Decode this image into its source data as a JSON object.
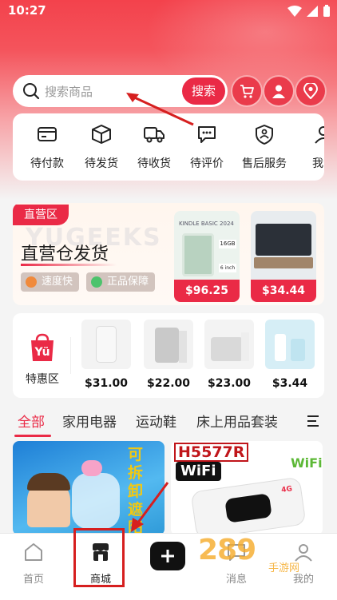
{
  "status_bar": {
    "time": "10:27"
  },
  "search": {
    "placeholder": "搜索商品",
    "button_label": "搜索"
  },
  "orders": {
    "items": [
      {
        "label": "待付款",
        "icon": "wallet-card-icon"
      },
      {
        "label": "待发货",
        "icon": "package-box-icon"
      },
      {
        "label": "待收货",
        "icon": "delivery-truck-icon"
      },
      {
        "label": "待评价",
        "icon": "comment-bubble-icon"
      },
      {
        "label": "售后服务",
        "icon": "after-sale-shield-icon"
      },
      {
        "label": "我的",
        "icon": "my-account-icon"
      }
    ]
  },
  "direct_zone": {
    "tag": "直营区",
    "title": "直营仓发货",
    "badges": [
      "速度快",
      "正品保障"
    ],
    "products": [
      {
        "price": "$96.25",
        "caption": "KINDLE BASIC 2024",
        "specs": [
          "16GB",
          "6 inch"
        ]
      },
      {
        "price": "$34.44"
      }
    ]
  },
  "special_zone": {
    "label": "特惠区",
    "products": [
      {
        "price": "$31.00"
      },
      {
        "price": "$22.00"
      },
      {
        "price": "$23.00"
      },
      {
        "price": "$3.44"
      }
    ]
  },
  "category_tabs": [
    "全部",
    "家用电器",
    "运动鞋",
    "床上用品套装"
  ],
  "feed": [
    {
      "text": "可拆卸遮阳棚"
    },
    {
      "model": "H5577R",
      "brand": "WiFi",
      "corner": "WiFi",
      "badge": "4G"
    }
  ],
  "bottom_nav": {
    "items": [
      {
        "label": "首页",
        "icon": "home-icon"
      },
      {
        "label": "商城",
        "icon": "mall-icon"
      },
      {
        "label": "",
        "icon": "plus-icon"
      },
      {
        "label": "消息",
        "icon": "message-icon"
      },
      {
        "label": "我的",
        "icon": "profile-icon"
      }
    ]
  },
  "watermark": {
    "logo": "289",
    "sub": "手游网"
  },
  "colors": {
    "brand": "#ea2a46",
    "highlight": "#d61f1f"
  }
}
